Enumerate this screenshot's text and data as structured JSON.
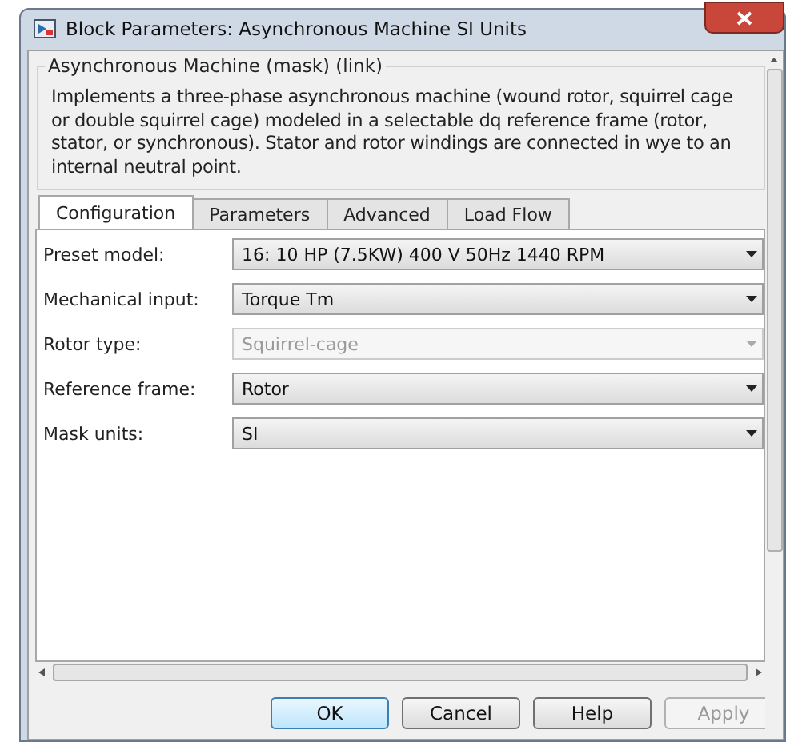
{
  "window": {
    "title": "Block Parameters: Asynchronous Machine SI Units"
  },
  "group": {
    "title": "Asynchronous Machine (mask) (link)",
    "description": "Implements a three-phase asynchronous machine (wound rotor, squirrel cage or double squirrel cage) modeled in a selectable dq reference frame (rotor, stator, or synchronous). Stator and rotor windings are connected in wye to an internal neutral point."
  },
  "tabs": [
    {
      "label": "Configuration",
      "selected": true
    },
    {
      "label": "Parameters",
      "selected": false
    },
    {
      "label": "Advanced",
      "selected": false
    },
    {
      "label": "Load Flow",
      "selected": false
    }
  ],
  "fields": [
    {
      "label": "Preset model:",
      "value": "16:  10 HP (7.5KW)  400 V 50Hz 1440 RPM",
      "disabled": false
    },
    {
      "label": "Mechanical input:",
      "value": "Torque Tm",
      "disabled": false
    },
    {
      "label": "Rotor type:",
      "value": "Squirrel-cage",
      "disabled": true
    },
    {
      "label": "Reference frame:",
      "value": "Rotor",
      "disabled": false
    },
    {
      "label": "Mask units:",
      "value": "SI",
      "disabled": false
    }
  ],
  "buttons": [
    {
      "label": "OK",
      "default": true,
      "disabled": false
    },
    {
      "label": "Cancel",
      "default": false,
      "disabled": false
    },
    {
      "label": "Help",
      "default": false,
      "disabled": false
    },
    {
      "label": "Apply",
      "default": false,
      "disabled": true
    }
  ]
}
